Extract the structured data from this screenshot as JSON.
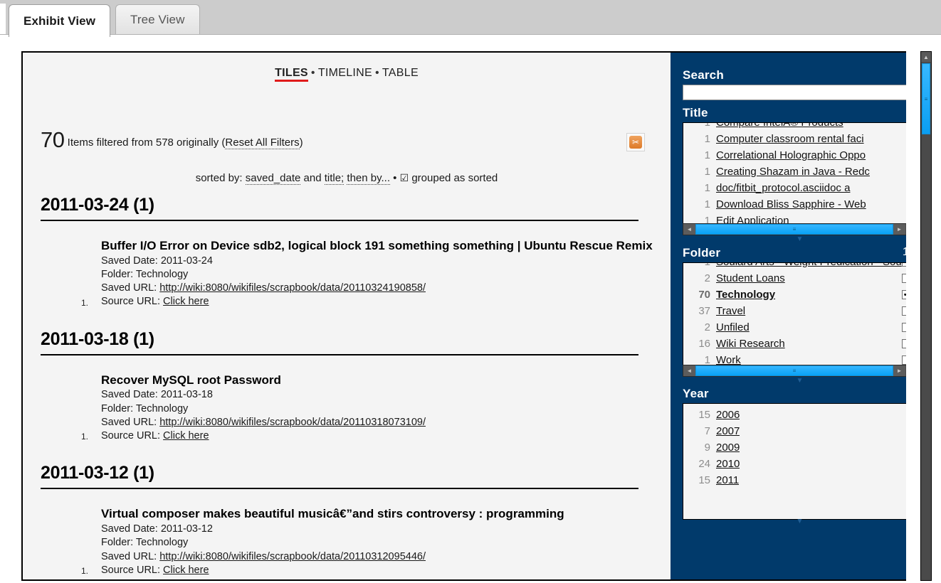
{
  "tabs": [
    {
      "label": "Exhibit View",
      "active": true
    },
    {
      "label": "Tree View",
      "active": false
    }
  ],
  "view_nav": {
    "items": [
      {
        "label": "TILES",
        "active": true
      },
      {
        "label": "TIMELINE",
        "active": false
      },
      {
        "label": "TABLE",
        "active": false
      }
    ],
    "separator": "•"
  },
  "summary": {
    "count": "70",
    "text_before": "Items filtered from 578 originally (",
    "reset_link": "Reset All Filters",
    "text_after": ")"
  },
  "sort": {
    "prefix": "sorted by:",
    "key1": "saved_date",
    "and": "and",
    "key2": "title;",
    "then_by": "then by...",
    "bullet": "•",
    "check_glyph": "☑",
    "grouped_label": "grouped as sorted"
  },
  "cut_button": {
    "icon": "scissors-icon",
    "glyph": "✂"
  },
  "groups": [
    {
      "heading": "2011-03-24 (1)",
      "items": [
        {
          "number": "1.",
          "title": "Buffer I/O Error on Device sdb2, logical block 191 something something | Ubuntu Rescue Remix",
          "saved_date_label": "Saved Date:",
          "saved_date": "2011-03-24",
          "folder_label": "Folder:",
          "folder": "Technology",
          "saved_url_label": "Saved URL:",
          "saved_url": "http://wiki:8080/wikifiles/scrapbook/data/20110324190858/",
          "source_url_label": "Source URL:",
          "source_url_link": "Click here"
        }
      ]
    },
    {
      "heading": "2011-03-18 (1)",
      "items": [
        {
          "number": "1.",
          "title": "Recover MySQL root Password",
          "saved_date_label": "Saved Date:",
          "saved_date": "2011-03-18",
          "folder_label": "Folder:",
          "folder": "Technology",
          "saved_url_label": "Saved URL:",
          "saved_url": "http://wiki:8080/wikifiles/scrapbook/data/20110318073109/",
          "source_url_label": "Source URL:",
          "source_url_link": "Click here"
        }
      ]
    },
    {
      "heading": "2011-03-12 (1)",
      "items": [
        {
          "number": "1.",
          "title": "Virtual composer makes beautiful musicâ€”and stirs controversy : programming",
          "saved_date_label": "Saved Date:",
          "saved_date": "2011-03-12",
          "folder_label": "Folder:",
          "folder": "Technology",
          "saved_url_label": "Saved URL:",
          "saved_url": "http://wiki:8080/wikifiles/scrapbook/data/20110312095446/",
          "source_url_label": "Source URL:",
          "source_url_link": "Click here"
        }
      ]
    }
  ],
  "sidebar": {
    "background": "#013a6b",
    "search": {
      "title": "Search",
      "value": "",
      "placeholder": ""
    },
    "title_facet": {
      "title": "Title",
      "clipped_top_row": {
        "count": "1",
        "label": "Compare IntelÂ® Products"
      },
      "rows": [
        {
          "count": "1",
          "label": "Computer classroom rental faci"
        },
        {
          "count": "1",
          "label": "Correlational Holographic Oppo"
        },
        {
          "count": "1",
          "label": "Creating Shazam in Java - Redc"
        },
        {
          "count": "1",
          "label": "doc/fitbit_protocol.asciidoc a"
        },
        {
          "count": "1",
          "label": "Download Bliss Sapphire - Web"
        },
        {
          "count": "1",
          "label": "Edit Application"
        }
      ]
    },
    "folder_facet": {
      "title": "Folder",
      "selected_count": "1",
      "header_check_glyph": "✔",
      "clipped_top_row": {
        "count": "1",
        "label": "Soulard Arts - Weight Predication - Sou"
      },
      "rows": [
        {
          "count": "2",
          "label": "Student Loans",
          "checked": false
        },
        {
          "count": "70",
          "label": "Technology",
          "checked": true
        },
        {
          "count": "37",
          "label": "Travel",
          "checked": false
        },
        {
          "count": "2",
          "label": "Unfiled",
          "checked": false
        },
        {
          "count": "16",
          "label": "Wiki Research",
          "checked": false
        },
        {
          "count": "1",
          "label": "Work",
          "checked": false
        }
      ],
      "check_glyph": "✔"
    },
    "year_facet": {
      "title": "Year",
      "rows": [
        {
          "count": "15",
          "label": "2006"
        },
        {
          "count": "7",
          "label": "2007"
        },
        {
          "count": "9",
          "label": "2009"
        },
        {
          "count": "24",
          "label": "2010"
        },
        {
          "count": "15",
          "label": "2011"
        }
      ]
    },
    "scroll_glyphs": {
      "up": "▲",
      "down": "▼",
      "left": "◄",
      "right": "►",
      "grip": "≡",
      "caret_down": "▼"
    }
  }
}
